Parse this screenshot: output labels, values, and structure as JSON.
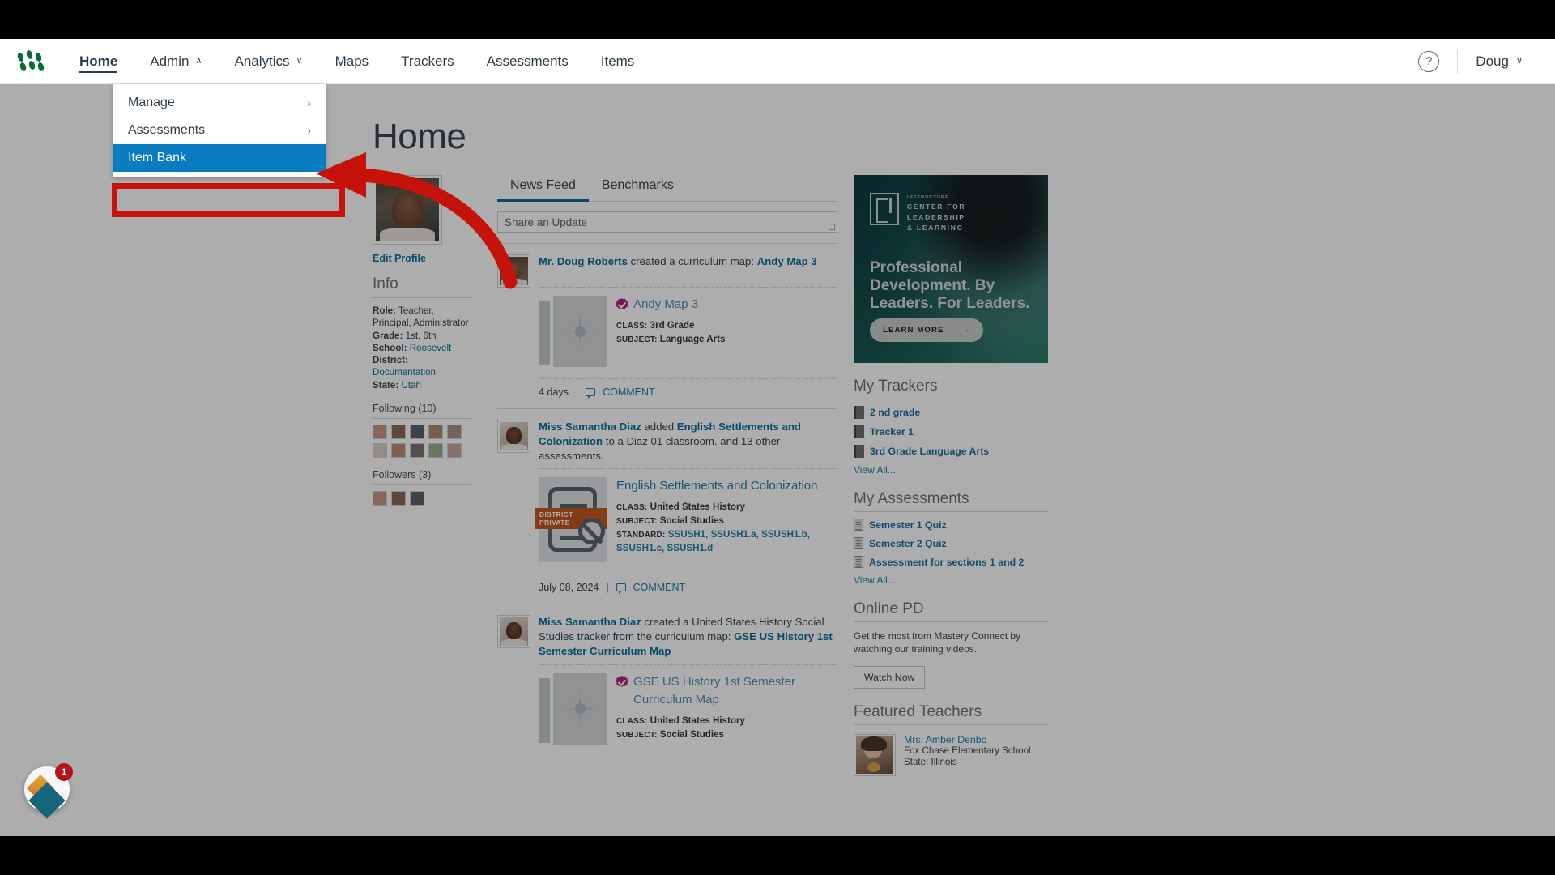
{
  "nav": {
    "logo_name": "mastery-connect-logo",
    "items": [
      {
        "label": "Home",
        "active": true,
        "caret": ""
      },
      {
        "label": "Admin",
        "active": false,
        "caret": "∧"
      },
      {
        "label": "Analytics",
        "active": false,
        "caret": "∨"
      },
      {
        "label": "Maps",
        "active": false,
        "caret": ""
      },
      {
        "label": "Trackers",
        "active": false,
        "caret": ""
      },
      {
        "label": "Assessments",
        "active": false,
        "caret": ""
      },
      {
        "label": "Items",
        "active": false,
        "caret": ""
      }
    ],
    "help_icon": "?",
    "user_label": "Doug",
    "user_caret": "∨"
  },
  "dropdown": {
    "items": [
      {
        "label": "Manage",
        "chevron": "›",
        "selected": false
      },
      {
        "label": "Assessments",
        "chevron": "›",
        "selected": false
      },
      {
        "label": "Item Bank",
        "chevron": "",
        "selected": true
      }
    ]
  },
  "page": {
    "title": "Home"
  },
  "profile": {
    "edit_link": "Edit Profile",
    "info_heading": "Info",
    "role_key": "Role:",
    "role_value": "Teacher, Principal, Administrator",
    "grade_key": "Grade:",
    "grade_value": "1st, 6th",
    "school_key": "School:",
    "school_value": "Roosevelt",
    "district_key": "District:",
    "district_value": "Documentation",
    "state_key": "State:",
    "state_value": "Utah",
    "following_label": "Following",
    "following_count": "(10)",
    "followers_label": "Followers",
    "followers_count": "(3)",
    "following_thumb_count": 10,
    "followers_thumb_count": 3
  },
  "feed": {
    "tabs": [
      {
        "label": "News Feed",
        "active": true
      },
      {
        "label": "Benchmarks",
        "active": false
      }
    ],
    "share_placeholder": "Share an Update",
    "posts": [
      {
        "author": "Mr. Doug Roberts",
        "action_before": " created a curriculum map: ",
        "link_text": "Andy Map 3",
        "action_after": "",
        "tile": "map",
        "item_title": "Andy Map 3",
        "verified": true,
        "meta": [
          {
            "key": "CLASS:",
            "value": "3rd Grade"
          },
          {
            "key": "SUBJECT:",
            "value": "Language Arts"
          }
        ],
        "standard_key": "",
        "standard_value": "",
        "date": "4 days",
        "comment_label": "COMMENT"
      },
      {
        "author": "Miss Samantha Diaz",
        "action_before": " added ",
        "link_text": "English Settlements and Colonization",
        "action_after": " to a Diaz 01 classroom. and 13 other assessments.",
        "tile": "doc",
        "tile_badge": "DISTRICT PRIVATE",
        "item_title": "English Settlements and Colonization",
        "verified": false,
        "meta": [
          {
            "key": "CLASS:",
            "value": "United States History"
          },
          {
            "key": "SUBJECT:",
            "value": "Social Studies"
          }
        ],
        "standard_key": "STANDARD:",
        "standard_value": "SSUSH1, SSUSH1.a, SSUSH1.b, SSUSH1.c, SSUSH1.d",
        "date": "July 08, 2024",
        "comment_label": "COMMENT"
      },
      {
        "author": "Miss Samantha Diaz",
        "action_before": " created a United States History Social Studies tracker from the curriculum map: ",
        "link_text": "GSE US History 1st Semester Curriculum Map",
        "action_after": "",
        "tile": "map",
        "item_title": "GSE US History 1st Semester Curriculum Map",
        "verified": true,
        "meta": [
          {
            "key": "CLASS:",
            "value": "United States History"
          },
          {
            "key": "SUBJECT:",
            "value": "Social Studies"
          }
        ],
        "standard_key": "",
        "standard_value": "",
        "date": "",
        "comment_label": ""
      }
    ]
  },
  "ad": {
    "brand_tiny": "INSTRUCTURE",
    "brand_line1": "CENTER FOR",
    "brand_line2": "LEADERSHIP",
    "brand_line3": "& LEARNING",
    "headline": "Professional Development. By Leaders. For Leaders.",
    "cta_label": "LEARN MORE",
    "cta_arrow": "→"
  },
  "sidebar": {
    "trackers_heading": "My Trackers",
    "trackers": [
      "2 nd grade",
      "Tracker 1",
      "3rd Grade Language Arts"
    ],
    "trackers_viewall": "View All...",
    "assessments_heading": "My Assessments",
    "assessments": [
      "Semester 1 Quiz",
      "Semester 2 Quiz",
      "Assessment for sections 1 and 2"
    ],
    "assessments_viewall": "View All...",
    "pd_heading": "Online PD",
    "pd_text": "Get the most from Mastery Connect by watching our training videos.",
    "pd_button": "Watch Now",
    "featured_heading": "Featured Teachers",
    "featured_name": "Mrs. Amber Denbo",
    "featured_school": "Fox Chase Elementary School",
    "featured_state": "State: Illinois"
  },
  "fab": {
    "badge_count": "1"
  },
  "colors": {
    "accent_blue": "#0a6f9e",
    "selected_blue": "#0a7cc1",
    "highlight_red": "#c5130b",
    "badge_magenta": "#b5247d",
    "private_orange": "#c5591f"
  }
}
